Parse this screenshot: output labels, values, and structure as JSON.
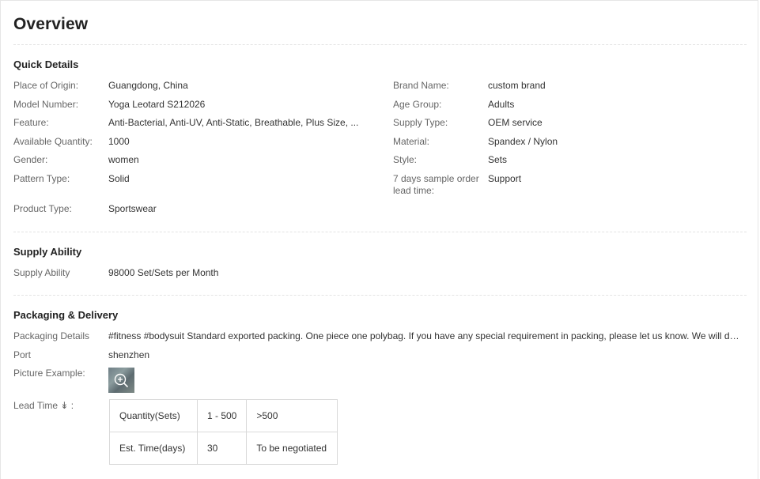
{
  "title": "Overview",
  "quick_details": {
    "heading": "Quick Details",
    "left": [
      {
        "label": "Place of Origin:",
        "value": "Guangdong, China"
      },
      {
        "label": "Model Number:",
        "value": "Yoga Leotard S212026"
      },
      {
        "label": "Feature:",
        "value": "Anti-Bacterial, Anti-UV, Anti-Static, Breathable, Plus Size, ..."
      },
      {
        "label": "Available Quantity:",
        "value": "1000"
      },
      {
        "label": "Gender:",
        "value": "women"
      },
      {
        "label": "Pattern Type:",
        "value": "Solid"
      },
      {
        "label": "Product Type:",
        "value": "Sportswear"
      }
    ],
    "right": [
      {
        "label": "Brand Name:",
        "value": "custom brand"
      },
      {
        "label": "Age Group:",
        "value": "Adults"
      },
      {
        "label": "Supply Type:",
        "value": "OEM service"
      },
      {
        "label": "Material:",
        "value": "Spandex / Nylon"
      },
      {
        "label": "Style:",
        "value": "Sets"
      },
      {
        "label": "7 days sample order lead time:",
        "value": "Support"
      }
    ]
  },
  "supply_ability": {
    "heading": "Supply Ability",
    "label": "Supply Ability",
    "value": "98000 Set/Sets per Month"
  },
  "packaging": {
    "heading": "Packaging & Delivery",
    "details_label": "Packaging Details",
    "details_value": "#fitness #bodysuit Standard exported packing. One piece one polybag. If you have any special requirement in packing, please let us know. We will do it as you require.",
    "port_label": "Port",
    "port_value": "shenzhen",
    "picture_label": "Picture Example:",
    "lead_label": "Lead Time ↡ :",
    "lead_table": [
      [
        "Quantity(Sets)",
        "1 - 500",
        ">500"
      ],
      [
        "Est. Time(days)",
        "30",
        "To be negotiated"
      ]
    ]
  }
}
